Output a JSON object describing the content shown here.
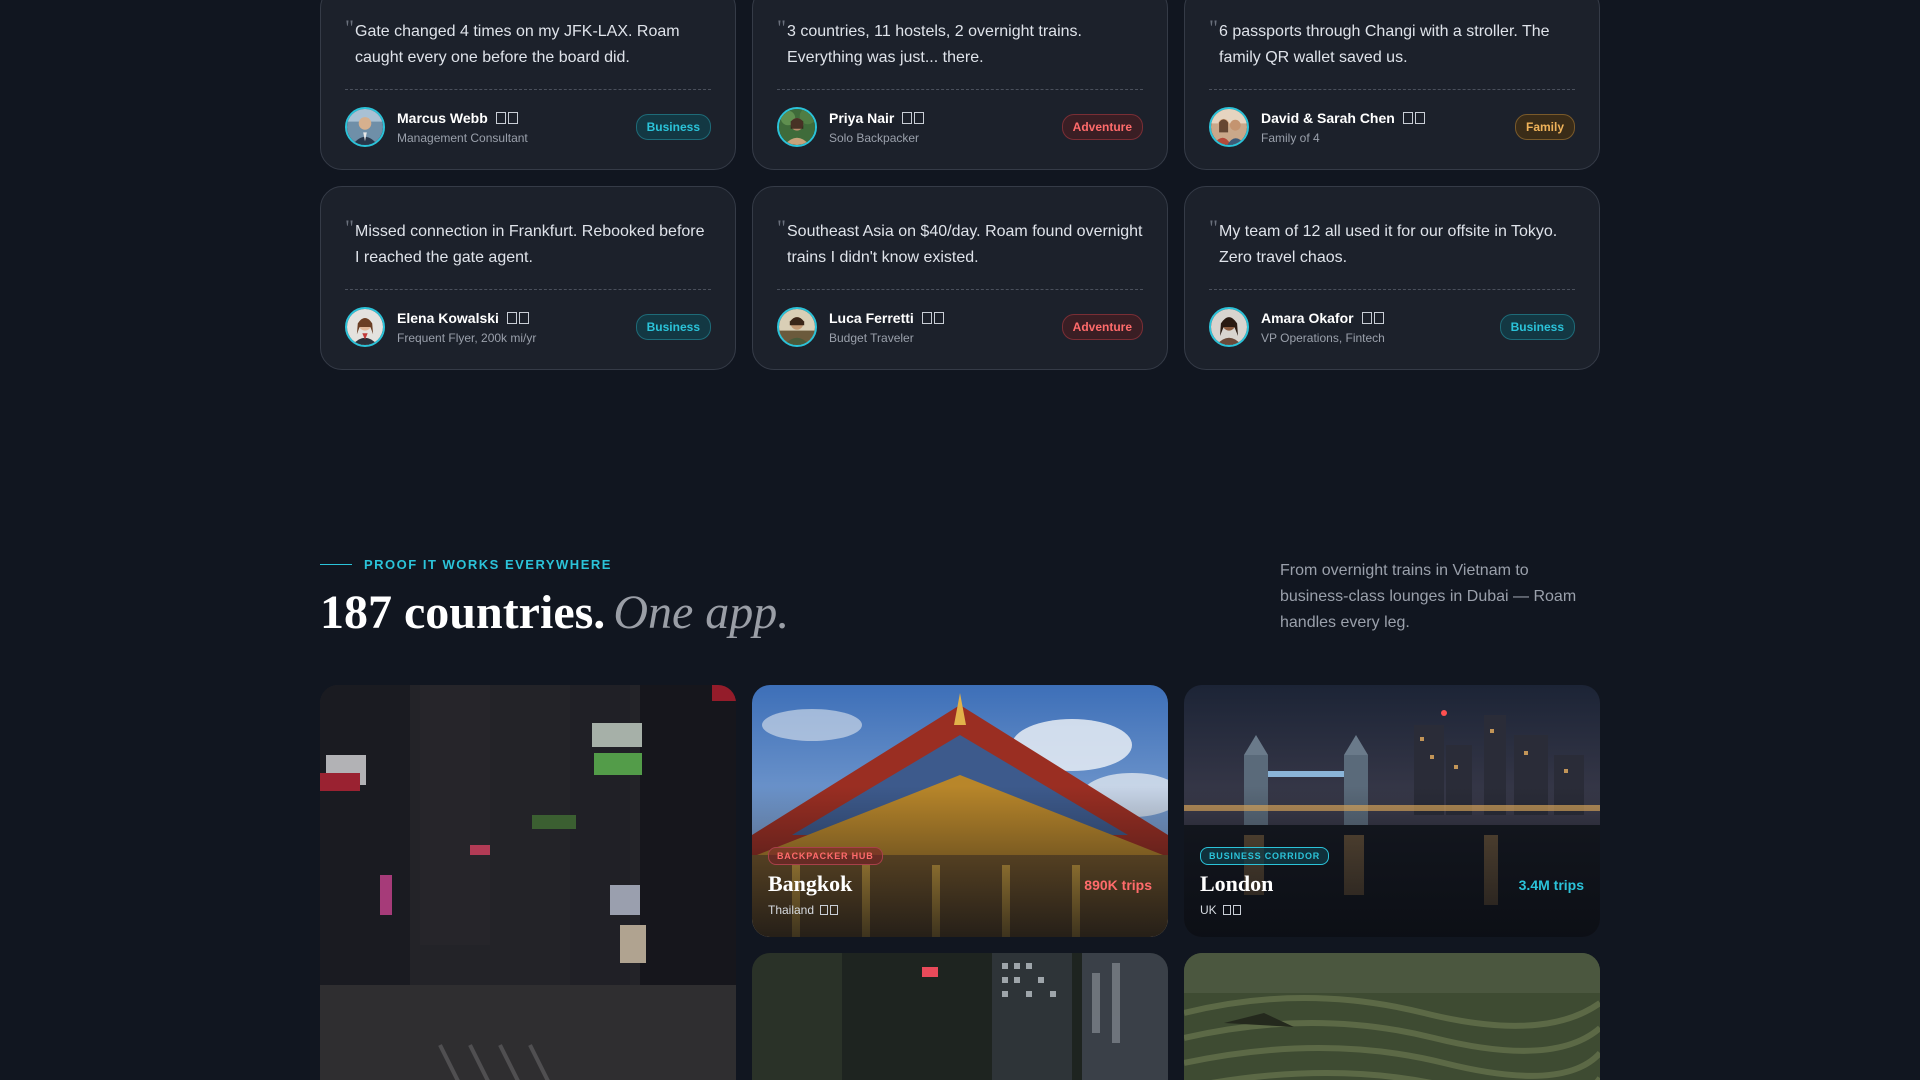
{
  "testimonials": [
    {
      "quote": "Gate changed 4 times on my JFK-LAX. Roam caught every one before the board did.",
      "name": "Marcus Webb",
      "role": "Management Consultant",
      "tag": "Business",
      "tag_kind": "business"
    },
    {
      "quote": "3 countries, 11 hostels, 2 overnight trains. Everything was just... there.",
      "name": "Priya Nair",
      "role": "Solo Backpacker",
      "tag": "Adventure",
      "tag_kind": "adventure"
    },
    {
      "quote": "6 passports through Changi with a stroller. The family QR wallet saved us.",
      "name": "David & Sarah Chen",
      "role": "Family of 4",
      "tag": "Family",
      "tag_kind": "family"
    },
    {
      "quote": "Missed connection in Frankfurt. Rebooked before I reached the gate agent.",
      "name": "Elena Kowalski",
      "role": "Frequent Flyer, 200k mi/yr",
      "tag": "Business",
      "tag_kind": "business"
    },
    {
      "quote": "Southeast Asia on $40/day. Roam found overnight trains I didn't know existed.",
      "name": "Luca Ferretti",
      "role": "Budget Traveler",
      "tag": "Adventure",
      "tag_kind": "adventure"
    },
    {
      "quote": "My team of 12 all used it for our offsite in Tokyo. Zero travel chaos.",
      "name": "Amara Okafor",
      "role": "VP Operations, Fintech",
      "tag": "Business",
      "tag_kind": "business"
    }
  ],
  "proof": {
    "eyebrow": "PROOF IT WORKS EVERYWHERE",
    "headline_main": "187 countries.",
    "headline_accent": "One app.",
    "lede": "From overnight trains in Vietnam to business-class lounges in Dubai — Roam handles every leg."
  },
  "destinations": {
    "bangkok": {
      "badge": "BACKPACKER HUB",
      "city": "Bangkok",
      "trips": "890K trips",
      "country": "Thailand"
    },
    "london": {
      "badge": "BUSINESS CORRIDOR",
      "city": "London",
      "trips": "3.4M trips",
      "country": "UK"
    }
  },
  "colors": {
    "accent": "#2bc3d9",
    "adventure": "#ff6b6b",
    "family": "#f0b35a",
    "background": "#111620"
  }
}
